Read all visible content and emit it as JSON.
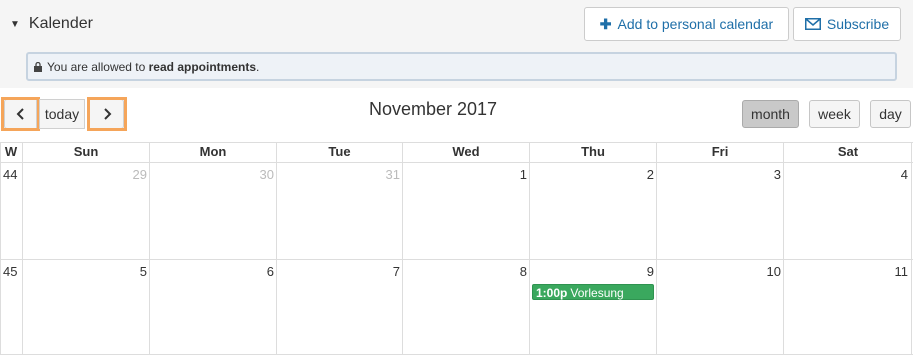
{
  "panel": {
    "title": "Kalender",
    "add_label": "Add to personal calendar",
    "subscribe_label": "Subscribe",
    "info_prefix": "You are allowed to ",
    "info_bold": "read appointments",
    "info_suffix": "."
  },
  "toolbar": {
    "prev": "‹",
    "today": "today",
    "next": "›",
    "title": "November 2017",
    "views": {
      "month": "month",
      "week": "week",
      "day": "day"
    },
    "active_view": "month"
  },
  "grid": {
    "headers": [
      "W",
      "Sun",
      "Mon",
      "Tue",
      "Wed",
      "Thu",
      "Fri",
      "Sat"
    ],
    "weeks": [
      {
        "week": "44",
        "days": [
          "29",
          "30",
          "31",
          "1",
          "2",
          "3",
          "4"
        ]
      },
      {
        "week": "45",
        "days": [
          "5",
          "6",
          "7",
          "8",
          "9",
          "10",
          "11"
        ]
      }
    ],
    "event": {
      "time": "1:00p",
      "title": "Vorlesung",
      "color": "#3aa85e"
    }
  },
  "colors": {
    "link": "#1f6fa8",
    "highlight": "#f5a55a",
    "info_bg": "#eef2f7"
  }
}
